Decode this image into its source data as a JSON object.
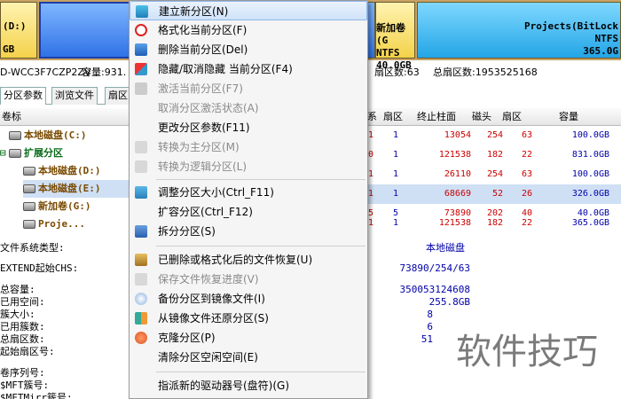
{
  "partitions": {
    "pc": {
      "line1": "(D:)",
      "line2": "GB"
    },
    "g": {
      "line1": "新加卷(G",
      "line2": "NTFS",
      "line3": "40.0GB"
    },
    "projects": {
      "line1": "Projects(BitLock",
      "line2": "NTFS",
      "line3": "365.0G"
    }
  },
  "disk_info": {
    "model": "D-WCC3F7CZP2ZV",
    "capacity_label": "容量:931.",
    "sector_tail": "扇区数:63",
    "total_sectors": "总扇区数:1953525168"
  },
  "tabs": [
    "分区参数",
    "浏览文件",
    "扇区"
  ],
  "tree": {
    "header": "卷标",
    "items": [
      "本地磁盘(C:)",
      "扩展分区",
      "本地磁盘(D:)",
      "本地磁盘(E:)",
      "新加卷(G:)",
      "Proje..."
    ]
  },
  "columns": {
    "col1": "系",
    "col2": "扇区",
    "col3": "终止柱面",
    "col4": "磁头",
    "col5": "扇区",
    "col6": "容量"
  },
  "rows": [
    {
      "a": "1",
      "b": "1",
      "c": "13054",
      "d": "254",
      "e": "63",
      "f": "100.0GB"
    },
    {
      "a": "0",
      "b": "1",
      "c": "121538",
      "d": "182",
      "e": "22",
      "f": "831.0GB"
    },
    {
      "a": "1",
      "b": "1",
      "c": "26110",
      "d": "254",
      "e": "63",
      "f": "100.0GB"
    },
    {
      "a": "1",
      "b": "1",
      "c": "68669",
      "d": "52",
      "e": "26",
      "f": "326.0GB"
    },
    {
      "a": "5",
      "b": "5",
      "c": "73890",
      "d": "202",
      "e": "40",
      "f": "40.0GB"
    },
    {
      "a": "1",
      "b": "1",
      "c": "121538",
      "d": "182",
      "e": "22",
      "f": "365.0GB"
    }
  ],
  "details": {
    "fs_label": "文件系统类型:",
    "fs_value": "本地磁盘",
    "chs_label": "EXTEND起始CHS:",
    "chs_value": "73890/254/63",
    "total_label": "总容量:",
    "total_value": "350053124608",
    "used_label": "已用空间:",
    "used_value": "255.8GB",
    "cluster_label": "簇大小:",
    "cluster_value": "8",
    "used_clusters_label": "已用簇数:",
    "used_clusters_value": "6",
    "total_sectors_label": "总扇区数:",
    "total_sectors_value": "51",
    "start_sector_label": "起始扇区号:",
    "serial_label": "卷序列号:",
    "mft_label": "$MFT簇号:",
    "mftmirr_label": "$MFTMirr簇号:"
  },
  "menu": {
    "items": [
      {
        "label": "建立新分区(N)",
        "icon": "new-partition-icon",
        "disabled": false,
        "highlighted": true
      },
      {
        "label": "格式化当前分区(F)",
        "icon": "format-icon",
        "disabled": false
      },
      {
        "label": "删除当前分区(Del)",
        "icon": "delete-icon",
        "disabled": false
      },
      {
        "label": "隐藏/取消隐藏 当前分区(F4)",
        "icon": "hide-icon",
        "disabled": false
      },
      {
        "label": "激活当前分区(F7)",
        "icon": "activate-icon",
        "disabled": true
      },
      {
        "label": "取消分区激活状态(A)",
        "icon": "",
        "disabled": true
      },
      {
        "label": "更改分区参数(F11)",
        "icon": "",
        "disabled": false
      },
      {
        "label": "转换为主分区(M)",
        "icon": "convert-primary-icon",
        "disabled": true
      },
      {
        "label": "转换为逻辑分区(L)",
        "icon": "convert-logical-icon",
        "disabled": true
      },
      {
        "label": "调整分区大小(Ctrl_F11)",
        "icon": "resize-icon",
        "disabled": false
      },
      {
        "label": "扩容分区(Ctrl_F12)",
        "icon": "",
        "disabled": false
      },
      {
        "label": "拆分分区(S)",
        "icon": "split-icon",
        "disabled": false
      },
      {
        "label": "已删除或格式化后的文件恢复(U)",
        "icon": "recover-icon",
        "disabled": false
      },
      {
        "label": "保存文件恢复进度(V)",
        "icon": "save-progress-icon",
        "disabled": true
      },
      {
        "label": "备份分区到镜像文件(I)",
        "icon": "backup-icon",
        "disabled": false
      },
      {
        "label": "从镜像文件还原分区(S)",
        "icon": "restore-icon",
        "disabled": false
      },
      {
        "label": "克隆分区(P)",
        "icon": "clone-icon",
        "disabled": false
      },
      {
        "label": "清除分区空闲空间(E)",
        "icon": "",
        "disabled": false
      },
      {
        "label": "指派新的驱动器号(盘符)(G)",
        "icon": "",
        "disabled": false
      }
    ]
  },
  "watermark": "软件技巧",
  "colors": {
    "highlight": "#cfe3fa",
    "disk_bar": "#c8a264",
    "selected_partition": "#2f72e6"
  }
}
